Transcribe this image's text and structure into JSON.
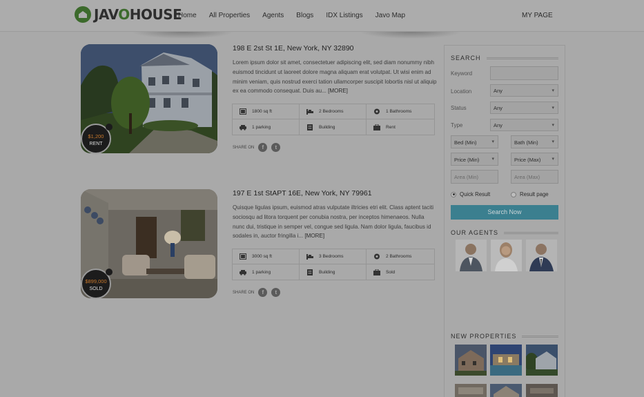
{
  "header": {
    "logo_part1": "JAV",
    "logo_o": "O",
    "logo_part2": "HOUSE",
    "nav": [
      "Home",
      "All Properties",
      "Agents",
      "Blogs",
      "IDX Listings",
      "Javo Map"
    ],
    "my_page": "MY PAGE"
  },
  "listings": [
    {
      "address": "198 E 2st St 1E, New York, NY 32890",
      "description": "Lorem ipsum dolor sit amet, consectetuer adipiscing elit, sed diam nonummy nibh euismod tincidunt ut laoreet dolore magna aliquam erat volutpat. Ut wisi enim ad minim veniam, quis nostrud exerci tation ullamcorper suscipit lobortis nisl ut aliquip ex ea commodo consequat. Duis au...",
      "more": "[MORE]",
      "price": "$1,200",
      "status": "RENT",
      "specs": [
        "1800 sq ft",
        "2 Bedrooms",
        "1 Bathrooms",
        "1 parking",
        "Building",
        "Rent"
      ],
      "share": "SHARE ON"
    },
    {
      "address": "197 E 1st StAPT 16E, New York, NY 79961",
      "description": "Quisque ligulas ipsum, euismod atras vulputate iltricies etri elit. Class aptent taciti sociosqu ad litora torquent per conubia nostra, per inceptos himenaeos. Nulla nunc dui, tristique in semper vel, congue sed ligula. Nam dolor ligula, faucibus id sodales in, auctor fringilla i...",
      "more": "[MORE]",
      "price": "$899,000",
      "status": "SOLD",
      "specs": [
        "3000 sq ft",
        "3 Bedrooms",
        "2 Bathrooms",
        "1 parking",
        "Building",
        "Sold"
      ],
      "share": "SHARE ON"
    }
  ],
  "social": {
    "facebook": "f",
    "twitter": "t"
  },
  "search": {
    "title": "SEARCH",
    "keyword_label": "Keyword",
    "keyword_value": "",
    "location_label": "Location",
    "location_value": "Any",
    "status_label": "Status",
    "status_value": "Any",
    "type_label": "Type",
    "type_value": "Any",
    "bed_min": "Bed (Min)",
    "bath_min": "Bath (Min)",
    "price_min": "Price (Min)",
    "price_max": "Price (Max)",
    "area_min_placeholder": "Area (Min)",
    "area_max_placeholder": "Area (Max)",
    "quick_result": "Quick Result",
    "result_page": "Result page",
    "button": "Search Now"
  },
  "agents_title": "OUR AGENTS",
  "new_properties_title": "NEW PROPERTIES",
  "spec_icons": [
    "area-icon",
    "bed-icon",
    "bath-icon",
    "car-icon",
    "building-icon",
    "briefcase-icon"
  ]
}
